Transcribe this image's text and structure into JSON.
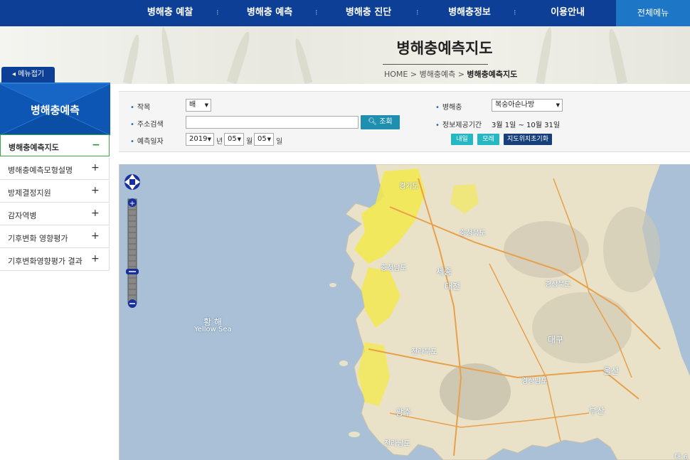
{
  "nav": {
    "items": [
      "병해충 예찰",
      "병해충 예측",
      "병해충 진단",
      "병해충정보",
      "이용안내"
    ],
    "all_menu": "전체메뉴"
  },
  "header": {
    "title": "병해충예측지도",
    "breadcrumb": {
      "home": "HOME",
      "sep": ">",
      "section": "병해충예측",
      "current": "병해충예측지도"
    }
  },
  "sidebar": {
    "toggle_label": "메뉴접기",
    "title": "병해충예측",
    "items": [
      {
        "label": "병해충예측지도",
        "symbol": "−"
      },
      {
        "label": "병해충예측모형설명",
        "symbol": "+"
      },
      {
        "label": "방제결정지원",
        "symbol": "+"
      },
      {
        "label": "감자역병",
        "symbol": "+"
      },
      {
        "label": "기후변화 영향평가",
        "symbol": "+"
      },
      {
        "label": "기후변화영향평가 결과",
        "symbol": "+"
      }
    ]
  },
  "filters": {
    "crop_label": "작목",
    "crop_value": "배",
    "address_label": "주소검색",
    "search_button": "조회",
    "date_label": "예측일자",
    "year": "2019",
    "year_unit": "년",
    "month": "05",
    "month_unit": "월",
    "day": "05",
    "day_unit": "일",
    "pest_label": "병해충",
    "pest_value": "복숭아순나방",
    "period_label": "정보제공기간",
    "period_value": "3월 1일 ~ 10월 31일",
    "tomorrow_button": "내일",
    "day_after_button": "모레",
    "reset_map_button": "지도위치초기화"
  },
  "map": {
    "sea_label_kr": "황 해",
    "sea_label_en": "Yellow Sea",
    "place_labels": [
      "경기도",
      "충청북도",
      "충청남도",
      "세종",
      "대전",
      "경상북도",
      "전라북도",
      "대구",
      "경상남도",
      "울산",
      "부산",
      "광주",
      "전라남도"
    ],
    "corner_text": "대 6"
  },
  "colors": {
    "nav_bg": "#0d3f97",
    "all_menu_bg": "#1d76c6",
    "sidebar_head_bg": "#0d56b3",
    "active_border": "#39a845",
    "search_btn": "#1f8fb0",
    "quick_btn": "#26b8c2",
    "reset_btn": "#173f7a"
  }
}
